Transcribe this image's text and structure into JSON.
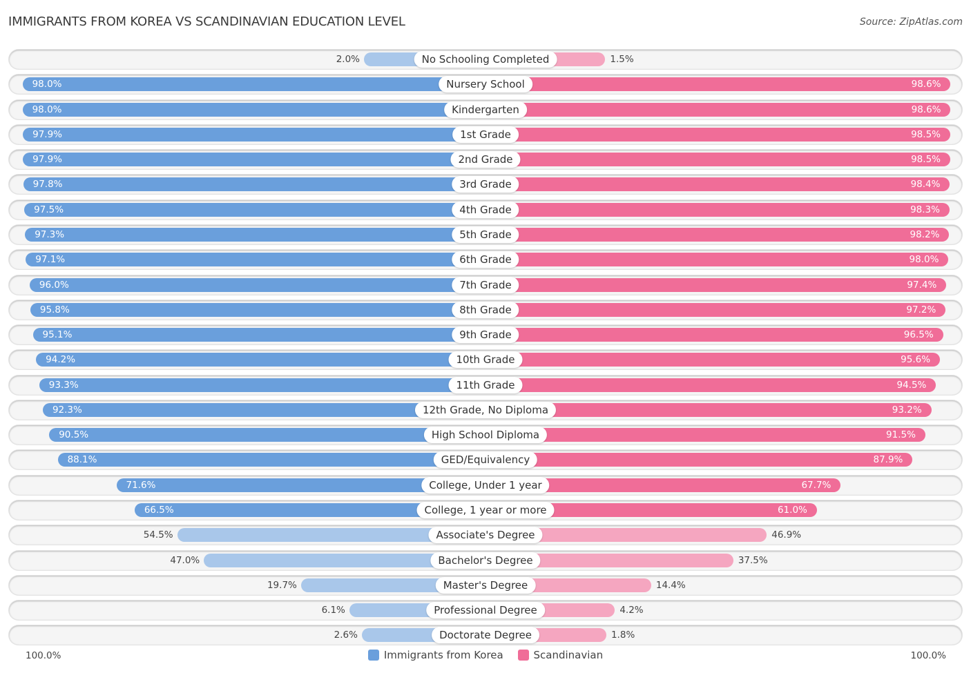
{
  "header": {
    "title": "IMMIGRANTS FROM KOREA VS SCANDINAVIAN EDUCATION LEVEL",
    "source": "Source: ZipAtlas.com"
  },
  "colors": {
    "left_strong": "#6a9fdc",
    "left_light": "#a9c7ea",
    "right_strong": "#f06d98",
    "right_light": "#f5a6c0"
  },
  "chart_data": {
    "type": "bar",
    "orientation": "horizontal-diverging",
    "title": "IMMIGRANTS FROM KOREA VS SCANDINAVIAN EDUCATION LEVEL",
    "xlabel": "",
    "ylabel": "",
    "xlim": [
      0,
      100
    ],
    "axis_left_label": "100.0%",
    "axis_right_label": "100.0%",
    "legend_position": "bottom-center",
    "categories": [
      "No Schooling Completed",
      "Nursery School",
      "Kindergarten",
      "1st Grade",
      "2nd Grade",
      "3rd Grade",
      "4th Grade",
      "5th Grade",
      "6th Grade",
      "7th Grade",
      "8th Grade",
      "9th Grade",
      "10th Grade",
      "11th Grade",
      "12th Grade, No Diploma",
      "High School Diploma",
      "GED/Equivalency",
      "College, Under 1 year",
      "College, 1 year or more",
      "Associate's Degree",
      "Bachelor's Degree",
      "Master's Degree",
      "Professional Degree",
      "Doctorate Degree"
    ],
    "series": [
      {
        "name": "Immigrants from Korea",
        "side": "left",
        "values": [
          2.0,
          98.0,
          98.0,
          97.9,
          97.9,
          97.8,
          97.5,
          97.3,
          97.1,
          96.0,
          95.8,
          95.1,
          94.2,
          93.3,
          92.3,
          90.5,
          88.1,
          71.6,
          66.5,
          54.5,
          47.0,
          19.7,
          6.1,
          2.6
        ],
        "labels": [
          "2.0%",
          "98.0%",
          "98.0%",
          "97.9%",
          "97.9%",
          "97.8%",
          "97.5%",
          "97.3%",
          "97.1%",
          "96.0%",
          "95.8%",
          "95.1%",
          "94.2%",
          "93.3%",
          "92.3%",
          "90.5%",
          "88.1%",
          "71.6%",
          "66.5%",
          "54.5%",
          "47.0%",
          "19.7%",
          "6.1%",
          "2.6%"
        ]
      },
      {
        "name": "Scandinavian",
        "side": "right",
        "values": [
          1.5,
          98.6,
          98.6,
          98.5,
          98.5,
          98.4,
          98.3,
          98.2,
          98.0,
          97.4,
          97.2,
          96.5,
          95.6,
          94.5,
          93.2,
          91.5,
          87.9,
          67.7,
          61.0,
          46.9,
          37.5,
          14.4,
          4.2,
          1.8
        ],
        "labels": [
          "1.5%",
          "98.6%",
          "98.6%",
          "98.5%",
          "98.5%",
          "98.4%",
          "98.3%",
          "98.2%",
          "98.0%",
          "97.4%",
          "97.2%",
          "96.5%",
          "95.6%",
          "94.5%",
          "93.2%",
          "91.5%",
          "87.9%",
          "67.7%",
          "61.0%",
          "46.9%",
          "37.5%",
          "14.4%",
          "4.2%",
          "1.8%"
        ]
      }
    ]
  },
  "legend": {
    "items": [
      {
        "label": "Immigrants from Korea",
        "color": "#6a9fdc"
      },
      {
        "label": "Scandinavian",
        "color": "#f06d98"
      }
    ]
  }
}
